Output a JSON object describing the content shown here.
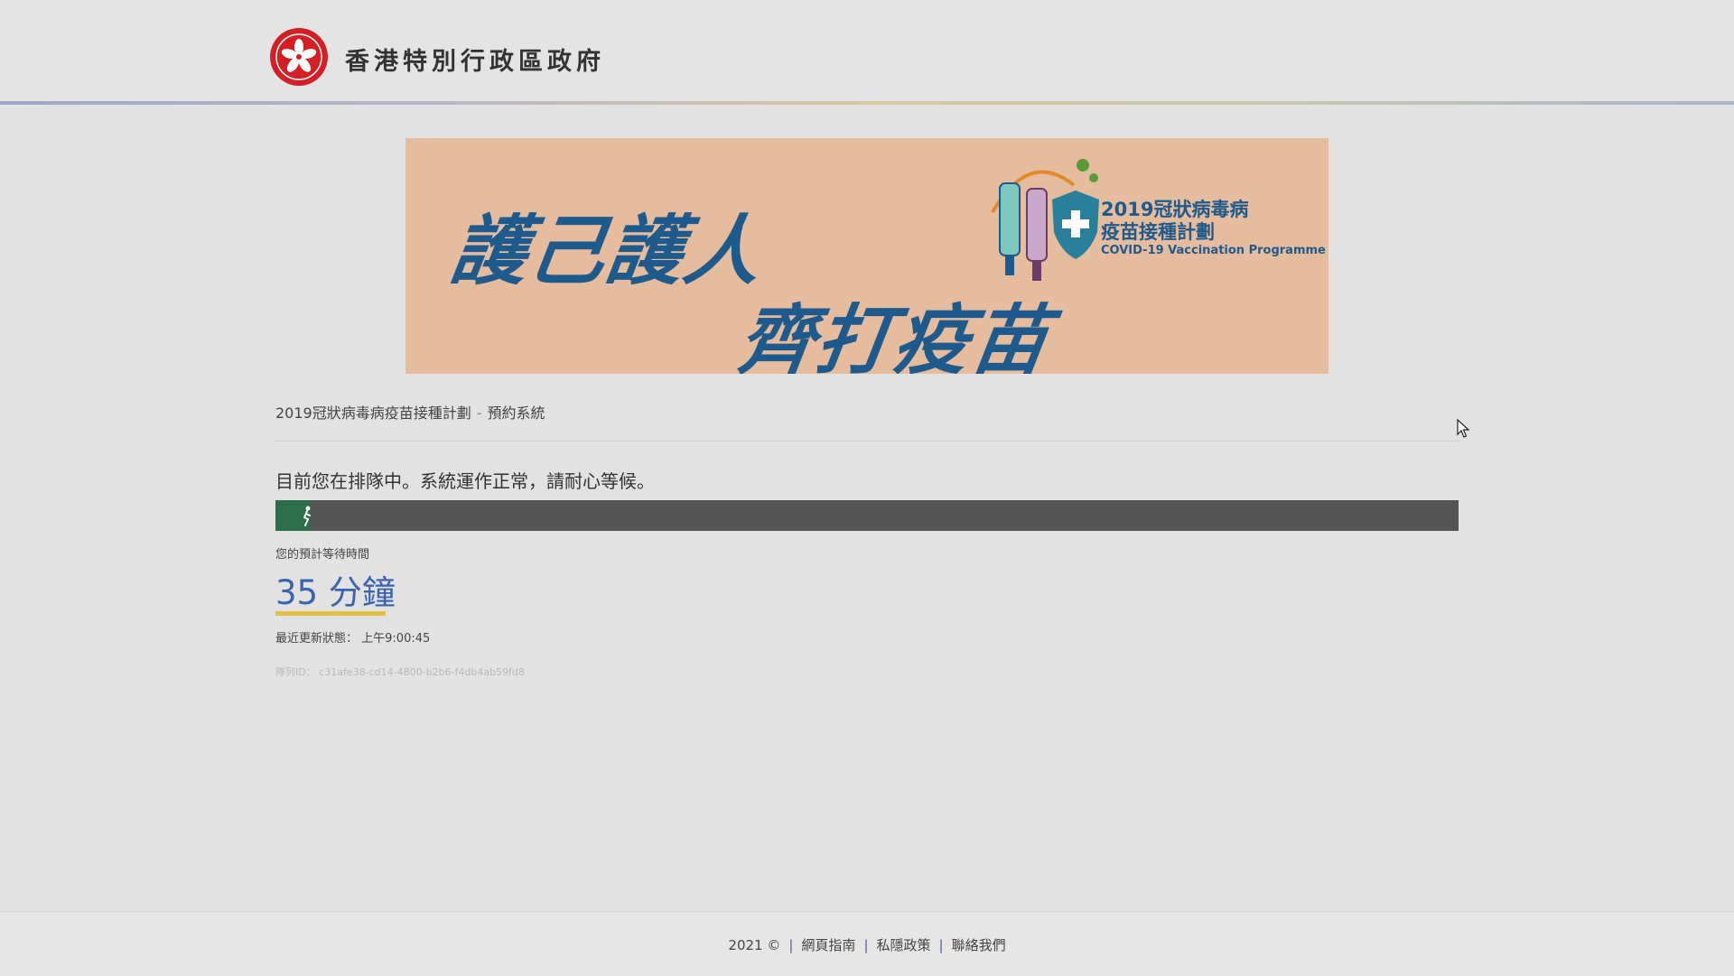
{
  "header": {
    "title": "香港特別行政區政府",
    "logo_icon": "hksar-bauhinia-emblem"
  },
  "banner": {
    "slogan_line1": "護己護人",
    "slogan_line2": "齊打疫苗",
    "programme_zh_line1": "2019冠狀病毒病",
    "programme_zh_line2": "疫苗接種計劃",
    "programme_en": "COVID-19 Vaccination Programme",
    "colors": {
      "background": "#e6bc9e",
      "text": "#1f5a8c"
    }
  },
  "breadcrumb": {
    "items": [
      "2019冠狀病毒病疫苗接種計劃",
      "預約系統"
    ],
    "separator": "-"
  },
  "queue": {
    "message": "目前您在排隊中。系統運作正常，請耐心等候。",
    "progress_percent": 3,
    "progress_icon": "runner-icon",
    "wait_label": "您的預計等待時間",
    "wait_value": "35 分鐘",
    "last_updated_label": "最近更新狀態：",
    "last_updated_value": "上午9:00:45",
    "queue_id_label": "隊列ID：",
    "queue_id_value": "c31afe38-cd14-4800-b2b6-f4db4ab59fd8",
    "colors": {
      "track": "#555555",
      "fill": "#2d6e4a",
      "wait_value": "#3a63b0",
      "underline": "#e2c043"
    }
  },
  "footer": {
    "copyright": "2021 ©",
    "links": [
      "網頁指南",
      "私隱政策",
      "聯絡我們"
    ]
  }
}
